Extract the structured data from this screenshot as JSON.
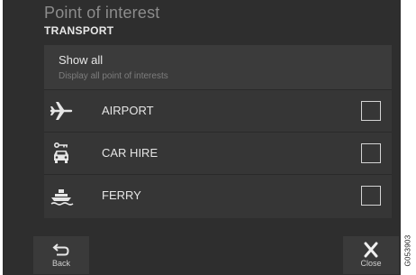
{
  "header": {
    "title": "Point of interest",
    "subtitle": "TRANSPORT"
  },
  "show_all": {
    "title": "Show all",
    "description": "Display all point of interests"
  },
  "categories": [
    {
      "label": "AIRPORT",
      "icon": "airplane-icon",
      "checked": false
    },
    {
      "label": "CAR HIRE",
      "icon": "car-hire-icon",
      "checked": false
    },
    {
      "label": "FERRY",
      "icon": "ferry-icon",
      "checked": false
    }
  ],
  "footer": {
    "back_label": "Back",
    "back_icon": "back-arrow-icon",
    "close_label": "Close",
    "close_icon": "close-icon"
  },
  "figure_code": "G053903",
  "colors": {
    "background": "#2e2e2e",
    "panel": "#363636",
    "text": "#e6e6e6",
    "muted_text": "#8c8c8c"
  }
}
